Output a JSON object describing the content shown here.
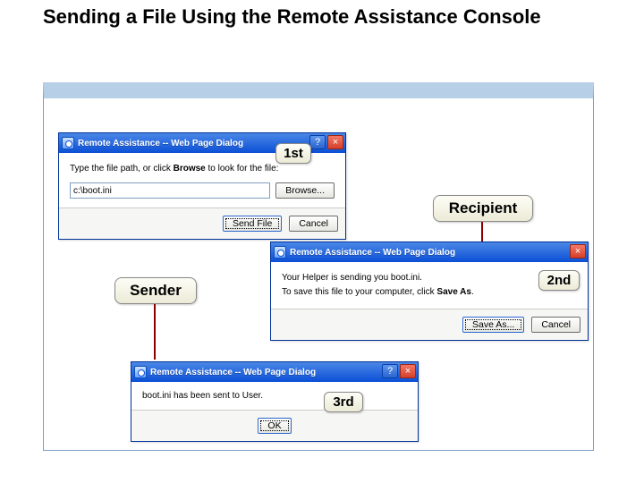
{
  "slide": {
    "title": "Sending a File Using the Remote Assistance Console"
  },
  "labels": {
    "first": "1st",
    "second": "2nd",
    "third": "3rd",
    "sender": "Sender",
    "recipient": "Recipient"
  },
  "dlg1": {
    "title": "Remote Assistance -- Web Page Dialog",
    "help_icon": "?",
    "close_icon": "×",
    "prompt_pre": "Type the file path, or click ",
    "prompt_bold": "Browse",
    "prompt_post": " to look for the file:",
    "filepath": "c:\\boot.ini",
    "browse": "Browse...",
    "send": "Send File",
    "cancel": "Cancel"
  },
  "dlg2": {
    "title": "Remote Assistance -- Web Page Dialog",
    "close_icon": "×",
    "line1": "Your Helper is sending you boot.ini.",
    "line2_pre": "To save this file to your computer, click ",
    "line2_bold": "Save As",
    "line2_post": ".",
    "save_as": "Save As...",
    "cancel": "Cancel"
  },
  "dlg3": {
    "title": "Remote Assistance -- Web Page Dialog",
    "help_icon": "?",
    "close_icon": "×",
    "msg": "boot.ini has been sent to User.",
    "ok": "OK"
  }
}
